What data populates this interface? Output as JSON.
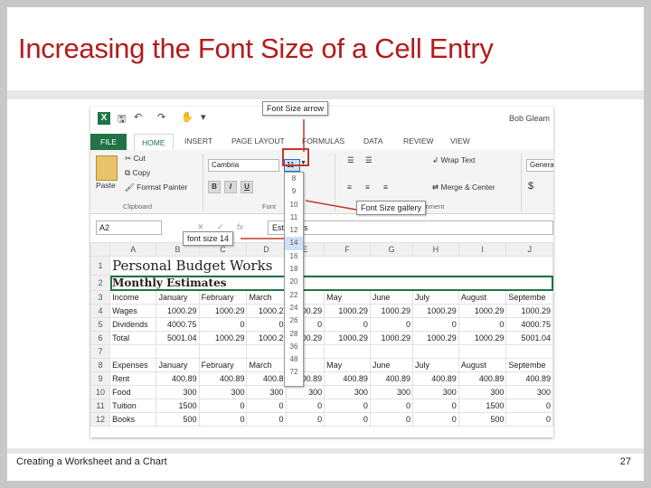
{
  "slide": {
    "title": "Increasing the Font Size of a Cell Entry",
    "footer_left": "Creating a Worksheet and a Chart",
    "page_number": "27"
  },
  "excel": {
    "user": "Bob Gleam",
    "tabs": [
      "FILE",
      "HOME",
      "INSERT",
      "PAGE LAYOUT",
      "FORMULAS",
      "DATA",
      "REVIEW",
      "VIEW"
    ],
    "clipboard": {
      "paste": "Paste",
      "cut": "Cut",
      "copy": "Copy",
      "format_painter": "Format Painter",
      "group": "Clipboard"
    },
    "font": {
      "name": "Cambria",
      "size": "11",
      "group": "Font",
      "bold": "B",
      "italic": "I",
      "underline": "U"
    },
    "alignment": {
      "wrap_text": "Wrap Text",
      "merge_center": "Merge & Center",
      "group": "Alignment"
    },
    "number": {
      "format": "General",
      "currency": "$"
    },
    "name_box": "A2",
    "formula_content": "Estimates",
    "font_size_gallery": [
      "8",
      "9",
      "10",
      "11",
      "12",
      "14",
      "16",
      "18",
      "20",
      "22",
      "24",
      "26",
      "28",
      "36",
      "48",
      "72"
    ],
    "selected_size": "14",
    "columns": [
      "A",
      "B",
      "C",
      "D",
      "E",
      "F",
      "G",
      "H",
      "I",
      "J"
    ],
    "rows": [
      {
        "n": "1",
        "cells": [
          "Personal Budget Works",
          "",
          "",
          "",
          "",
          "",
          "",
          "",
          "",
          ""
        ]
      },
      {
        "n": "2",
        "cells": [
          "Monthly Estimates",
          "",
          "",
          "",
          "",
          "",
          "",
          "",
          "",
          ""
        ]
      },
      {
        "n": "3",
        "cells": [
          "Income",
          "January",
          "February",
          "March",
          "",
          "May",
          "June",
          "July",
          "August",
          "Septembe"
        ]
      },
      {
        "n": "4",
        "cells": [
          "Wages",
          "1000.29",
          "1000.29",
          "1000.2",
          "00.29",
          "1000.29",
          "1000.29",
          "1000.29",
          "1000.29",
          "1000.29"
        ]
      },
      {
        "n": "5",
        "cells": [
          "Dividends",
          "4000.75",
          "0",
          "0",
          "0",
          "0",
          "0",
          "0",
          "0",
          "4000.75"
        ]
      },
      {
        "n": "6",
        "cells": [
          "Total",
          "5001.04",
          "1000.29",
          "1000.2",
          "00.29",
          "1000.29",
          "1000.29",
          "1000.29",
          "1000.29",
          "5001.04"
        ]
      },
      {
        "n": "7",
        "cells": [
          "",
          "",
          "",
          "",
          "",
          "",
          "",
          "",
          "",
          ""
        ]
      },
      {
        "n": "8",
        "cells": [
          "Expenses",
          "January",
          "February",
          "March",
          "",
          "May",
          "June",
          "July",
          "August",
          "Septembe"
        ]
      },
      {
        "n": "9",
        "cells": [
          "Rent",
          "400.89",
          "400.89",
          "400.8",
          "00.89",
          "400.89",
          "400.89",
          "400.89",
          "400.89",
          "400.89"
        ]
      },
      {
        "n": "10",
        "cells": [
          "Food",
          "300",
          "300",
          "300",
          "300",
          "300",
          "300",
          "300",
          "300",
          "300"
        ]
      },
      {
        "n": "11",
        "cells": [
          "Tuition",
          "1500",
          "0",
          "0",
          "0",
          "0",
          "0",
          "0",
          "1500",
          "0"
        ]
      },
      {
        "n": "12",
        "cells": [
          "Books",
          "500",
          "0",
          "0",
          "0",
          "0",
          "0",
          "0",
          "500",
          "0"
        ]
      }
    ],
    "callouts": {
      "font_size_arrow": "Font Size arrow",
      "font_size_gallery": "Font Size gallery",
      "font_size_14": "font size 14"
    }
  }
}
